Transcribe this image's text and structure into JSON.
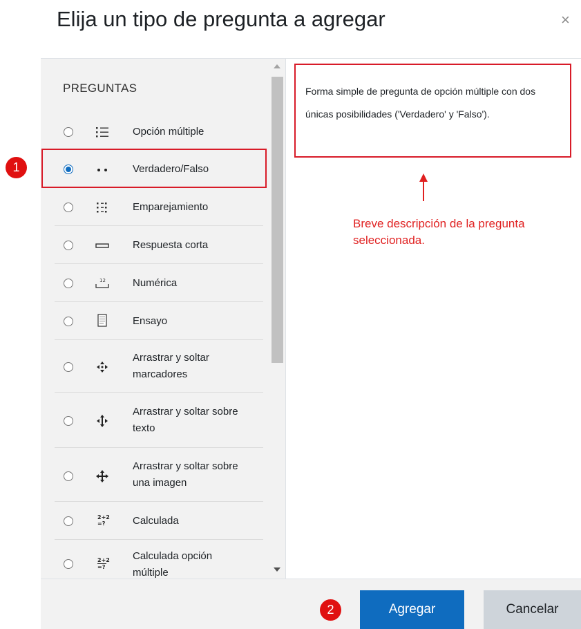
{
  "dialog": {
    "title": "Elija un tipo de pregunta a agregar",
    "close_label": "×"
  },
  "list": {
    "section_heading": "PREGUNTAS",
    "items": [
      {
        "label": "Opción múltiple",
        "icon": "multiple-choice-icon",
        "selected": false
      },
      {
        "label": "Verdadero/Falso",
        "icon": "true-false-icon",
        "selected": true
      },
      {
        "label": "Emparejamiento",
        "icon": "matching-icon",
        "selected": false
      },
      {
        "label": "Respuesta corta",
        "icon": "short-answer-icon",
        "selected": false
      },
      {
        "label": "Numérica",
        "icon": "numerical-icon",
        "selected": false
      },
      {
        "label": "Ensayo",
        "icon": "essay-icon",
        "selected": false
      },
      {
        "label": "Arrastrar y soltar marcadores",
        "icon": "drag-markers-icon",
        "selected": false
      },
      {
        "label": "Arrastrar y soltar sobre texto",
        "icon": "drag-text-icon",
        "selected": false
      },
      {
        "label": "Arrastrar y soltar sobre una imagen",
        "icon": "drag-image-icon",
        "selected": false
      },
      {
        "label": "Calculada",
        "icon": "calculated-icon",
        "selected": false
      },
      {
        "label": "Calculada opción múltiple",
        "icon": "calculated-multichoice-icon",
        "selected": false
      }
    ]
  },
  "description": {
    "text": "Forma simple de pregunta de opción múltiple con dos únicas posibilidades ('Verdadero' y 'Falso')."
  },
  "annotations": {
    "marker_1": "1",
    "marker_2": "2",
    "note": "Breve descripción de la pregunta seleccionada."
  },
  "footer": {
    "add_label": "Agregar",
    "cancel_label": "Cancelar"
  },
  "colors": {
    "primary": "#0f6cbf",
    "highlight_red": "#d81b28",
    "annotation_red": "#e02020"
  }
}
